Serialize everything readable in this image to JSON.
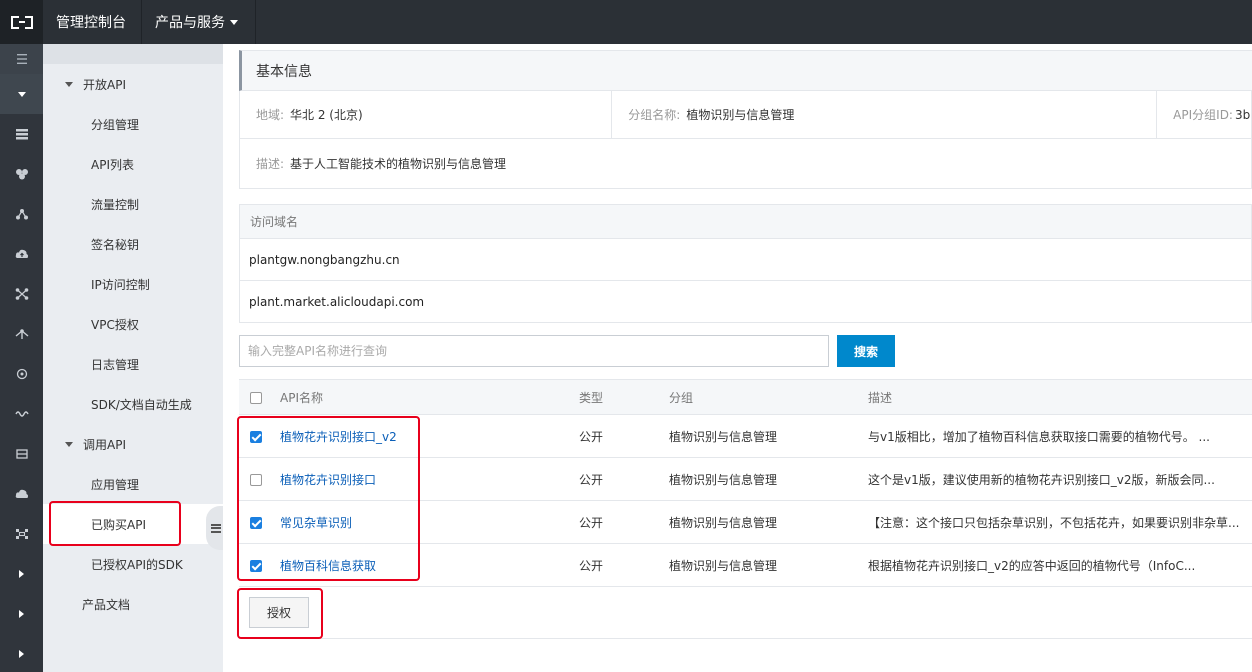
{
  "topbar": {
    "console_label": "管理控制台",
    "products_label": "产品与服务"
  },
  "sidebar": {
    "groups": [
      {
        "label": "开放API",
        "items": [
          "分组管理",
          "API列表",
          "流量控制",
          "签名秘钥",
          "IP访问控制",
          "VPC授权",
          "日志管理",
          "SDK/文档自动生成"
        ]
      },
      {
        "label": "调用API",
        "items": [
          "应用管理",
          "已购买API",
          "已授权API的SDK"
        ]
      }
    ],
    "doc_label": "产品文档",
    "active_item": "已购买API"
  },
  "basic_info": {
    "title": "基本信息",
    "region_key": "地域:",
    "region_value": "华北 2 (北京)",
    "group_name_key": "分组名称:",
    "group_name_value": "植物识别与信息管理",
    "group_id_key": "API分组ID:",
    "group_id_value": "3b",
    "desc_key": "描述:",
    "desc_value": "基于人工智能技术的植物识别与信息管理"
  },
  "domains": {
    "header": "访问域名",
    "items": [
      "plantgw.nongbangzhu.cn",
      "plant.market.alicloudapi.com"
    ]
  },
  "search": {
    "placeholder": "输入完整API名称进行查询",
    "button_label": "搜索"
  },
  "table": {
    "headers": {
      "name": "API名称",
      "type": "类型",
      "group": "分组",
      "desc": "描述"
    },
    "rows": [
      {
        "checked": true,
        "name": "植物花卉识别接口_v2",
        "type": "公开",
        "group": "植物识别与信息管理",
        "desc": "与v1版相比，增加了植物百科信息获取接口需要的植物代号。 ..."
      },
      {
        "checked": false,
        "name": "植物花卉识别接口",
        "type": "公开",
        "group": "植物识别与信息管理",
        "desc": "这个是v1版，建议使用新的植物花卉识别接口_v2版，新版会同..."
      },
      {
        "checked": true,
        "name": "常见杂草识别",
        "type": "公开",
        "group": "植物识别与信息管理",
        "desc": "【注意：这个接口只包括杂草识别，不包括花卉，如果要识别非杂草..."
      },
      {
        "checked": true,
        "name": "植物百科信息获取",
        "type": "公开",
        "group": "植物识别与信息管理",
        "desc": "根据植物花卉识别接口_v2的应答中返回的植物代号（InfoC..."
      }
    ]
  },
  "actions": {
    "authorize_label": "授权"
  },
  "colors": {
    "topbar_bg": "#2b3036",
    "sidebar_bg": "#eaedf1",
    "primary_button": "#0088cc",
    "link": "#0b5fb8",
    "annotation_red": "#e8001c"
  }
}
